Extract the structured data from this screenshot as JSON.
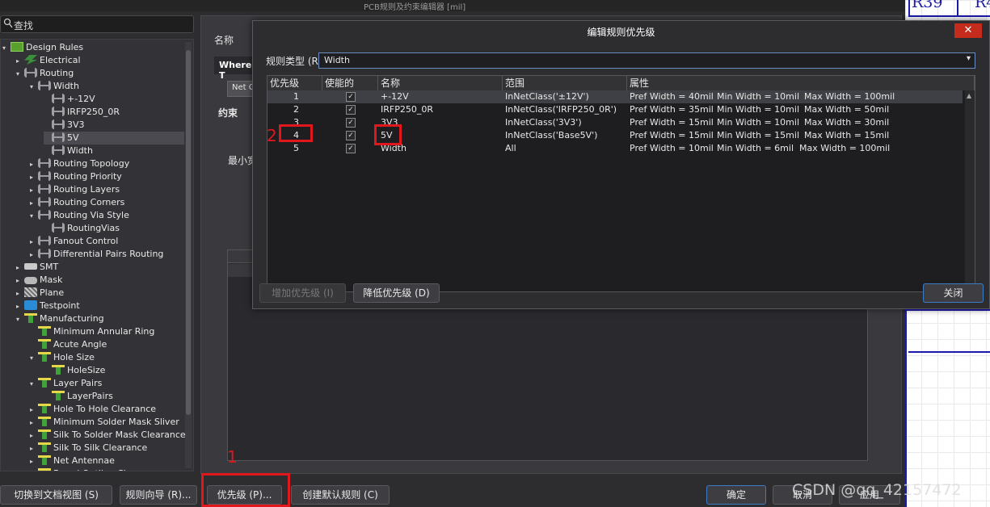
{
  "main_window": {
    "title": "PCB规则及约束编辑器 [mil]",
    "search_placeholder": "查找",
    "name_label": "名称",
    "where_label": "Where T",
    "net_btn": "Net C",
    "constraints_label": "约束",
    "min_label": "最小宽"
  },
  "tree": [
    {
      "label": "Design Rules",
      "level": 0,
      "arrow": "▾",
      "icon": "rules"
    },
    {
      "label": "Electrical",
      "level": 1,
      "arrow": "▸",
      "icon": "elec"
    },
    {
      "label": "Routing",
      "level": 1,
      "arrow": "▾",
      "icon": "route"
    },
    {
      "label": "Width",
      "level": 2,
      "arrow": "▾",
      "icon": "route"
    },
    {
      "label": "+-12V",
      "level": 3,
      "arrow": "",
      "icon": "route"
    },
    {
      "label": "IRFP250_0R",
      "level": 3,
      "arrow": "",
      "icon": "route"
    },
    {
      "label": "3V3",
      "level": 3,
      "arrow": "",
      "icon": "route"
    },
    {
      "label": "5V",
      "level": 3,
      "arrow": "",
      "icon": "route",
      "selected": true
    },
    {
      "label": "Width",
      "level": 3,
      "arrow": "",
      "icon": "route"
    },
    {
      "label": "Routing Topology",
      "level": 2,
      "arrow": "▸",
      "icon": "route"
    },
    {
      "label": "Routing Priority",
      "level": 2,
      "arrow": "▸",
      "icon": "route"
    },
    {
      "label": "Routing Layers",
      "level": 2,
      "arrow": "▸",
      "icon": "route"
    },
    {
      "label": "Routing Corners",
      "level": 2,
      "arrow": "▸",
      "icon": "route"
    },
    {
      "label": "Routing Via Style",
      "level": 2,
      "arrow": "▾",
      "icon": "route"
    },
    {
      "label": "RoutingVias",
      "level": 3,
      "arrow": "",
      "icon": "route"
    },
    {
      "label": "Fanout Control",
      "level": 2,
      "arrow": "▸",
      "icon": "route"
    },
    {
      "label": "Differential Pairs Routing",
      "level": 2,
      "arrow": "▸",
      "icon": "route"
    },
    {
      "label": "SMT",
      "level": 1,
      "arrow": "▸",
      "icon": "smt"
    },
    {
      "label": "Mask",
      "level": 1,
      "arrow": "▸",
      "icon": "mask"
    },
    {
      "label": "Plane",
      "level": 1,
      "arrow": "▸",
      "icon": "plane"
    },
    {
      "label": "Testpoint",
      "level": 1,
      "arrow": "▸",
      "icon": "test"
    },
    {
      "label": "Manufacturing",
      "level": 1,
      "arrow": "▾",
      "icon": "mfg"
    },
    {
      "label": "Minimum Annular Ring",
      "level": 2,
      "arrow": "",
      "icon": "mfg"
    },
    {
      "label": "Acute Angle",
      "level": 2,
      "arrow": "",
      "icon": "mfg"
    },
    {
      "label": "Hole Size",
      "level": 2,
      "arrow": "▾",
      "icon": "mfg"
    },
    {
      "label": "HoleSize",
      "level": 3,
      "arrow": "",
      "icon": "mfg"
    },
    {
      "label": "Layer Pairs",
      "level": 2,
      "arrow": "▾",
      "icon": "mfg"
    },
    {
      "label": "LayerPairs",
      "level": 3,
      "arrow": "",
      "icon": "mfg"
    },
    {
      "label": "Hole To Hole Clearance",
      "level": 2,
      "arrow": "▸",
      "icon": "mfg"
    },
    {
      "label": "Minimum Solder Mask Sliver",
      "level": 2,
      "arrow": "▸",
      "icon": "mfg"
    },
    {
      "label": "Silk To Solder Mask Clearance",
      "level": 2,
      "arrow": "▸",
      "icon": "mfg"
    },
    {
      "label": "Silk To Silk Clearance",
      "level": 2,
      "arrow": "▸",
      "icon": "mfg"
    },
    {
      "label": "Net Antennae",
      "level": 2,
      "arrow": "▸",
      "icon": "mfg"
    },
    {
      "label": "Board Outline Cl",
      "level": 2,
      "arrow": "▸",
      "icon": "mfg"
    }
  ],
  "bottom_buttons": {
    "doc_view": "切换到文档视图 (S)",
    "wizard": "规则向导 (R)...",
    "priority": "优先级 (P)...",
    "default_rules": "创建默认规则 (C)",
    "ok": "确定",
    "cancel": "取消",
    "apply": "应用"
  },
  "annotations": {
    "mark1": "1",
    "mark2": "2"
  },
  "pcb": {
    "label1": "R39",
    "label2": "R4"
  },
  "modal": {
    "title": "编辑规则优先级",
    "close": "✕",
    "rule_type_label": "规则类型 (R",
    "rule_type_value": "Width",
    "columns": [
      "优先级",
      "使能的",
      "名称",
      "范围",
      "属性"
    ],
    "rows": [
      {
        "priority": "1",
        "enabled": true,
        "name": "+-12V",
        "scope": "InNetClass('±12V')",
        "pref": "Pref Width = 40mil",
        "min": "Min Width = 10mil",
        "max": "Max Width = 100mil"
      },
      {
        "priority": "2",
        "enabled": true,
        "name": "IRFP250_0R",
        "scope": "InNetClass('IRFP250_0R')",
        "pref": "Pref Width = 35mil",
        "min": "Min Width = 10mil",
        "max": "Max Width = 50mil"
      },
      {
        "priority": "3",
        "enabled": true,
        "name": "3V3",
        "scope": "InNetClass('3V3')",
        "pref": "Pref Width = 15mil",
        "min": "Min Width = 10mil",
        "max": "Max Width = 30mil"
      },
      {
        "priority": "4",
        "enabled": true,
        "name": "5V",
        "scope": "InNetClass('Base5V')",
        "pref": "Pref Width = 15mil",
        "min": "Min Width = 15mil",
        "max": "Max Width = 15mil"
      },
      {
        "priority": "5",
        "enabled": true,
        "name": "Width",
        "scope": "All",
        "pref": "Pref Width = 10mil",
        "min": "Min Width = 6mil",
        "max": "Max Width = 100mil"
      }
    ],
    "raise_btn": "增加优先级 (I)",
    "lower_btn": "降低优先级 (D)",
    "close_btn": "关闭"
  },
  "watermark": "CSDN @qq_42157472"
}
